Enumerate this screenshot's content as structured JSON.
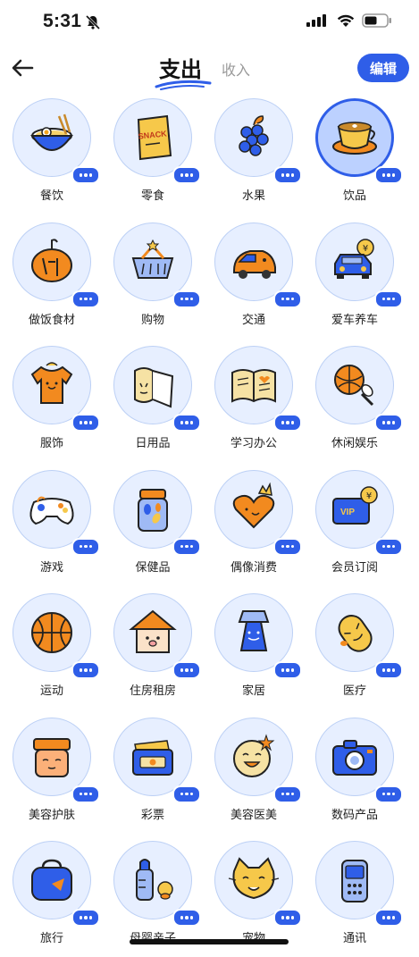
{
  "status_bar": {
    "time": "5:31"
  },
  "nav": {
    "title_active": "支出",
    "title_inactive": "收入",
    "edit_label": "编辑"
  },
  "colors": {
    "accent": "#2f5ee8",
    "circle_bg": "#e7efff",
    "circle_selected_bg": "#bcd1ff",
    "orange": "#f28a1f"
  },
  "categories": [
    {
      "label": "餐饮",
      "icon": "noodle-bowl-icon",
      "selected": false
    },
    {
      "label": "零食",
      "icon": "snack-bag-icon",
      "selected": false
    },
    {
      "label": "水果",
      "icon": "grapes-icon",
      "selected": false
    },
    {
      "label": "饮品",
      "icon": "coffee-cup-icon",
      "selected": true
    },
    {
      "label": "做饭食材",
      "icon": "pumpkin-icon",
      "selected": false
    },
    {
      "label": "购物",
      "icon": "shopping-basket-icon",
      "selected": false
    },
    {
      "label": "交通",
      "icon": "car-icon",
      "selected": false
    },
    {
      "label": "爱车养车",
      "icon": "car-money-icon",
      "selected": false
    },
    {
      "label": "服饰",
      "icon": "tshirt-icon",
      "selected": false
    },
    {
      "label": "日用品",
      "icon": "tissue-roll-icon",
      "selected": false
    },
    {
      "label": "学习办公",
      "icon": "open-book-icon",
      "selected": false
    },
    {
      "label": "休闲娱乐",
      "icon": "basketball-racket-icon",
      "selected": false
    },
    {
      "label": "游戏",
      "icon": "gamepad-icon",
      "selected": false
    },
    {
      "label": "保健品",
      "icon": "pill-jar-icon",
      "selected": false
    },
    {
      "label": "偶像消费",
      "icon": "idol-heart-crown-icon",
      "selected": false
    },
    {
      "label": "会员订阅",
      "icon": "vip-card-icon",
      "selected": false
    },
    {
      "label": "运动",
      "icon": "basketball-icon",
      "selected": false
    },
    {
      "label": "住房租房",
      "icon": "house-face-icon",
      "selected": false
    },
    {
      "label": "家居",
      "icon": "lamp-icon",
      "selected": false
    },
    {
      "label": "医疗",
      "icon": "capsule-icon",
      "selected": false
    },
    {
      "label": "美容护肤",
      "icon": "cream-jar-icon",
      "selected": false
    },
    {
      "label": "彩票",
      "icon": "lottery-ticket-icon",
      "selected": false
    },
    {
      "label": "美容医美",
      "icon": "smile-face-icon",
      "selected": false
    },
    {
      "label": "数码产品",
      "icon": "camera-icon",
      "selected": false
    },
    {
      "label": "旅行",
      "icon": "travel-bag-icon",
      "selected": false
    },
    {
      "label": "母婴亲子",
      "icon": "baby-bottle-icon",
      "selected": false
    },
    {
      "label": "宠物",
      "icon": "cat-face-icon",
      "selected": false
    },
    {
      "label": "通讯",
      "icon": "phone-icon",
      "selected": false
    }
  ]
}
